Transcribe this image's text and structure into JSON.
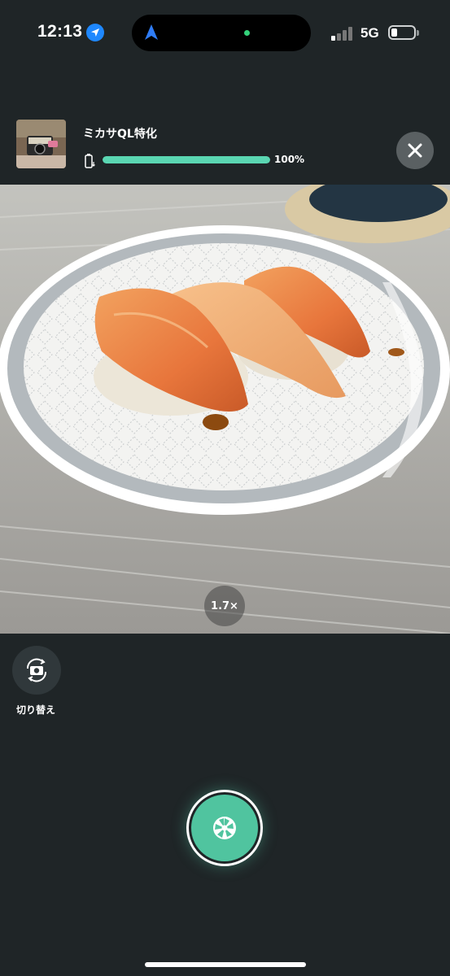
{
  "status_bar": {
    "time": "12:13",
    "network": "5G",
    "icons": [
      "location-icon",
      "navigation-arrow-icon",
      "signal-icon",
      "battery-icon"
    ]
  },
  "header": {
    "device_name": "ミカサQL特化",
    "progress_percent": 100,
    "progress_text": "100%",
    "accent_color": "#5ad6b2",
    "icons": [
      "charging-icon",
      "close-icon"
    ]
  },
  "camera": {
    "zoom_label": "1.7×"
  },
  "controls": {
    "switch_label": "切り替え",
    "icons": [
      "camera-switch-icon",
      "shutter-icon"
    ]
  }
}
